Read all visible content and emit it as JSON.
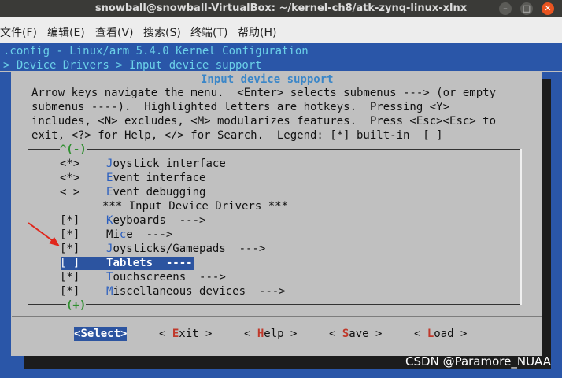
{
  "window": {
    "title": "snowball@snowball-VirtualBox: ~/kernel-ch8/atk-zynq-linux-xlnx"
  },
  "menu": [
    "文件(F)",
    "编辑(E)",
    "查看(V)",
    "搜索(S)",
    "终端(T)",
    "帮助(H)"
  ],
  "header": {
    "line1": ".config - Linux/arm 5.4.0 Kernel Configuration",
    "line2": "> Device Drivers > Input device support"
  },
  "dialog": {
    "title": "Input device support",
    "help": [
      "Arrow keys navigate the menu.  <Enter> selects submenus ---> (or empty",
      "submenus ----).  Highlighted letters are hotkeys.  Pressing <Y>",
      "includes, <N> excludes, <M> modularizes features.  Press <Esc><Esc> to",
      "exit, <?> for Help, </> for Search.  Legend: [*] built-in  [ ]"
    ],
    "scroll_up": "^(-)",
    "scroll_down": "(+)",
    "items": [
      {
        "mark": "<*>",
        "hot": "J",
        "rest": "oystick interface"
      },
      {
        "mark": "<*>",
        "hot": "E",
        "rest": "vent interface"
      },
      {
        "mark": "< >",
        "hot": "E",
        "rest": "vent debugging"
      },
      {
        "mark": "",
        "hot": "",
        "rest": "*** Input Device Drivers ***"
      },
      {
        "mark": "[*]",
        "hot": "K",
        "rest": "eyboards  --->"
      },
      {
        "mark": "[*]",
        "hot": "",
        "rest": "Mi",
        "hot2": "c",
        "rest2": "e  --->"
      },
      {
        "mark": "[*]",
        "hot": "J",
        "rest": "oysticks/Gamepads  --->"
      },
      {
        "mark": "[ ]",
        "hot": "T",
        "rest": "ablets  ----"
      },
      {
        "mark": "[*]",
        "hot": "T",
        "rest": "ouchscreens  --->"
      },
      {
        "mark": "[*]",
        "hot": "M",
        "rest": "iscellaneous devices  --->"
      }
    ],
    "selected_index": 7,
    "buttons": [
      {
        "pre": "<",
        "hot": "S",
        "rest": "elect>"
      },
      {
        "pre": "< ",
        "hot": "E",
        "rest": "xit >"
      },
      {
        "pre": "< ",
        "hot": "H",
        "rest": "elp >"
      },
      {
        "pre": "< ",
        "hot": "S",
        "rest": "ave >"
      },
      {
        "pre": "< ",
        "hot": "L",
        "rest": "oad >"
      }
    ]
  },
  "watermark": "CSDN @Paramore_NUAA",
  "colors": {
    "selection": "#2c54a0",
    "hotkey": "#2b5fbf",
    "terminal_bg": "#2a56a8",
    "arrow": "#e0261b"
  }
}
